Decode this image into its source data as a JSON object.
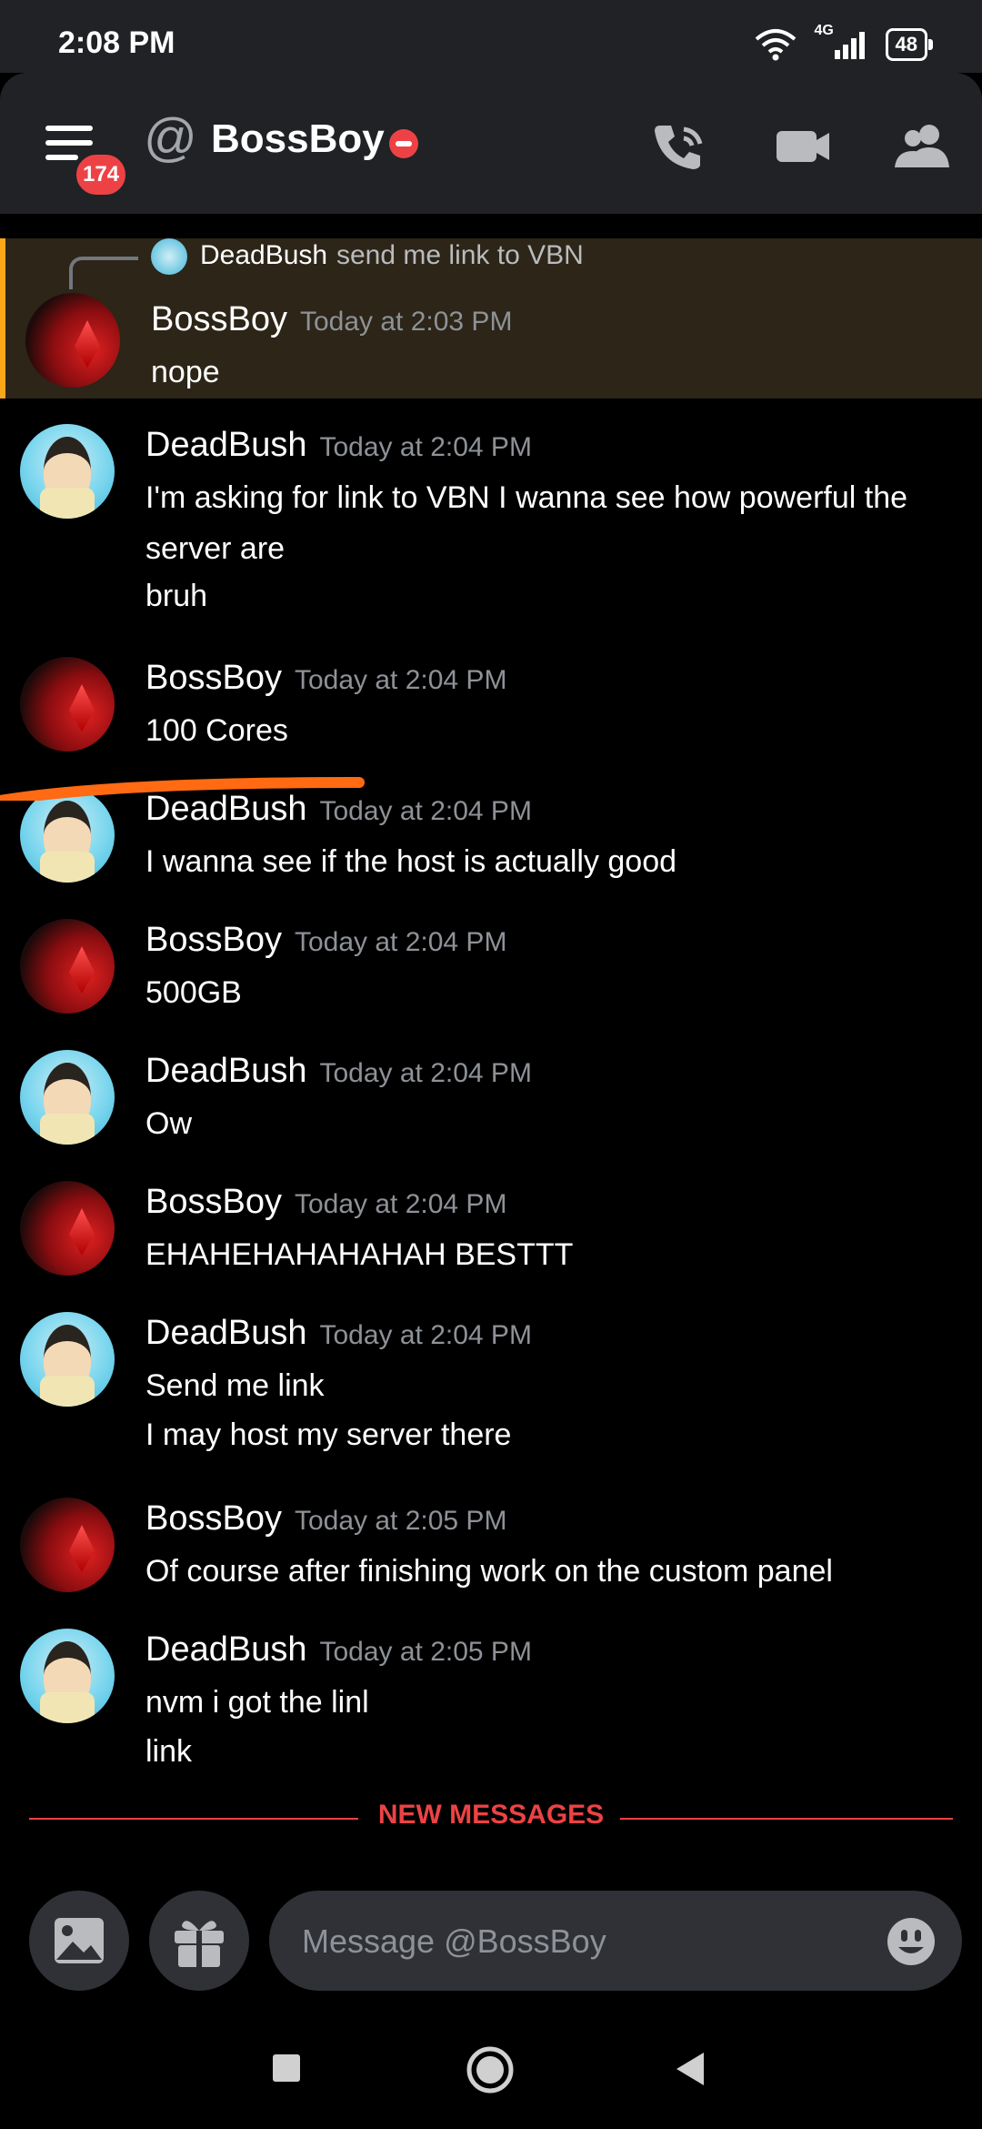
{
  "status_bar": {
    "time": "2:08 PM",
    "network": "4G",
    "battery": "48"
  },
  "header": {
    "unread_badge": "174",
    "at_symbol": "@",
    "title": "BossBoy"
  },
  "reply_preview": {
    "author": "DeadBush",
    "text": "send me link to VBN"
  },
  "messages": [
    {
      "author": "BossBoy",
      "timestamp": "Today at 2:03 PM",
      "lines": [
        "nope"
      ]
    },
    {
      "author": "DeadBush",
      "timestamp": "Today at 2:04 PM",
      "lines": [
        "I'm asking for link to VBN I wanna see how powerful the",
        "server are",
        "bruh"
      ]
    },
    {
      "author": "BossBoy",
      "timestamp": "Today at 2:04 PM",
      "lines": [
        "100 Cores"
      ]
    },
    {
      "author": "DeadBush",
      "timestamp": "Today at 2:04 PM",
      "lines": [
        "I wanna see if the host is actually good"
      ]
    },
    {
      "author": "BossBoy",
      "timestamp": "Today at 2:04 PM",
      "lines": [
        "500GB"
      ]
    },
    {
      "author": "DeadBush",
      "timestamp": "Today at 2:04 PM",
      "lines": [
        "Ow"
      ]
    },
    {
      "author": "BossBoy",
      "timestamp": "Today at 2:04 PM",
      "lines": [
        "EHAHEHAHAHAHAH BESTTT"
      ]
    },
    {
      "author": "DeadBush",
      "timestamp": "Today at 2:04 PM",
      "lines": [
        "Send me link",
        "I may host my server there"
      ]
    },
    {
      "author": "BossBoy",
      "timestamp": "Today at 2:05 PM",
      "lines": [
        "Of course after finishing work on the custom panel"
      ]
    },
    {
      "author": "DeadBush",
      "timestamp": "Today at 2:05 PM",
      "lines": [
        "nvm i got the linl",
        "link"
      ]
    }
  ],
  "new_messages_divider": "NEW MESSAGES",
  "composer": {
    "placeholder": "Message @BossBoy"
  },
  "colors": {
    "accent_red": "#ed4245",
    "highlight_bar": "#faa81a",
    "background": "#000000",
    "annotation": "#ff6a13"
  }
}
